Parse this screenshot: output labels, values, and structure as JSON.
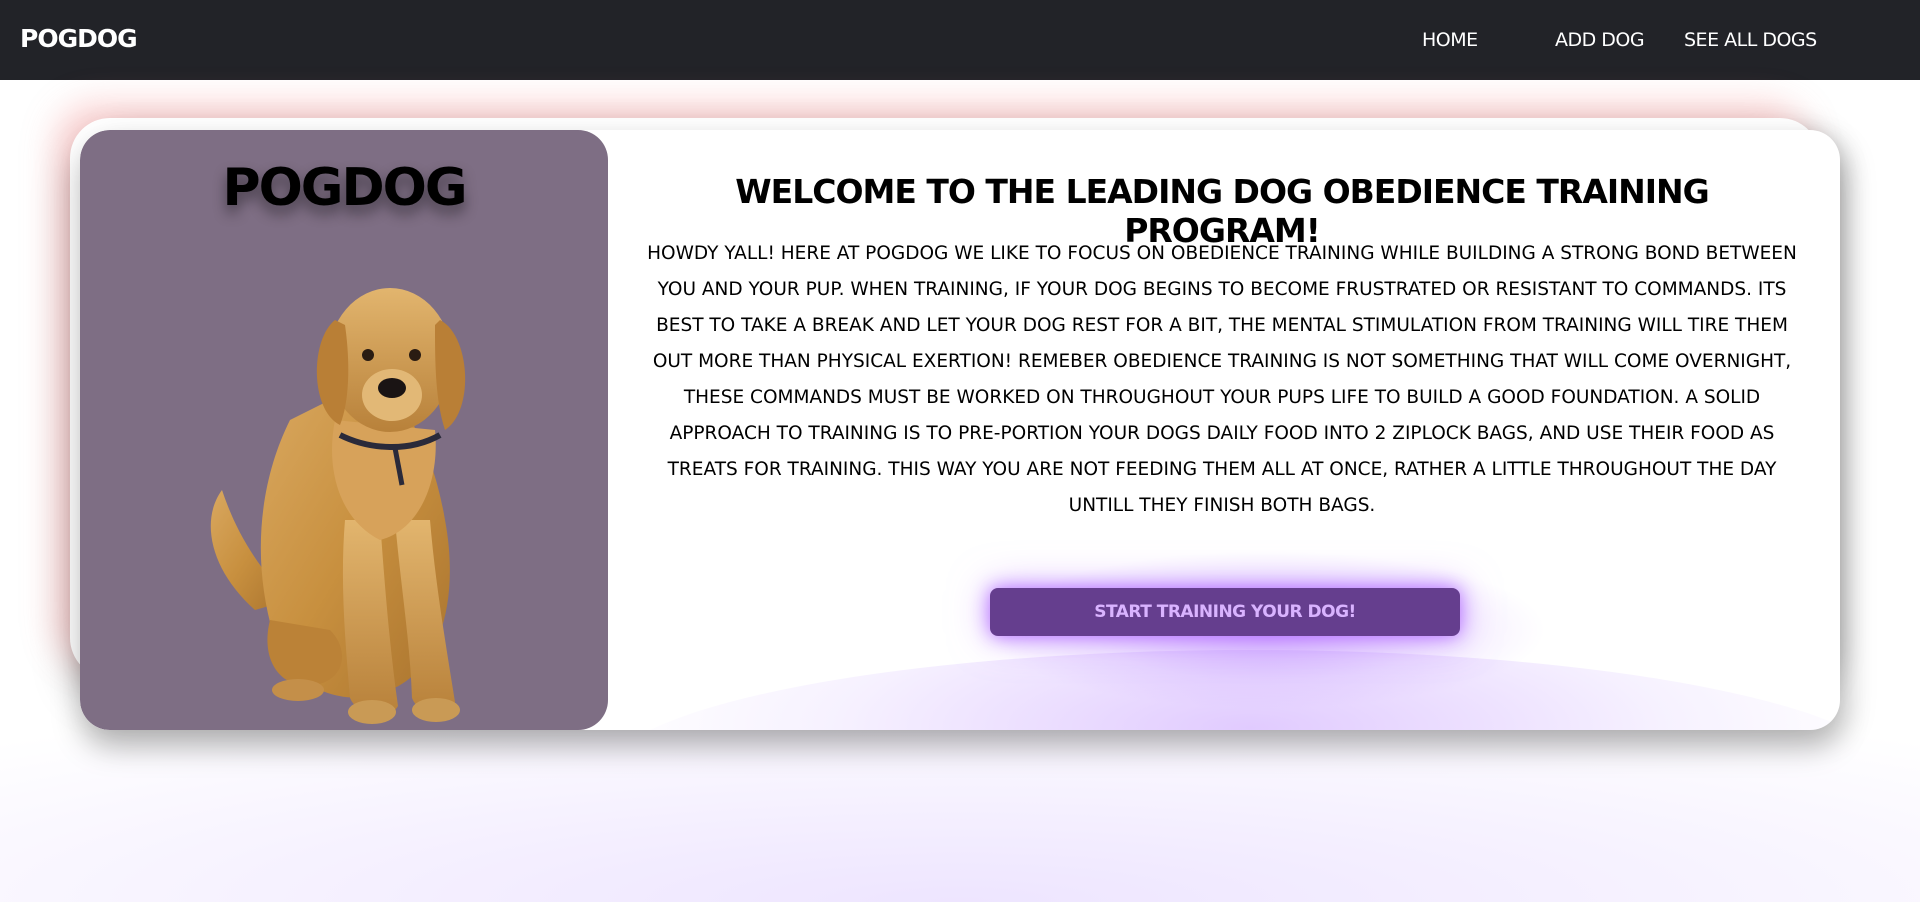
{
  "navbar": {
    "brand": "POGDOG",
    "links": {
      "home": "HOME",
      "add_dog": "ADD DOG",
      "see_all": "SEE ALL DOGS"
    }
  },
  "hero": {
    "title": "POGDOG",
    "image_icon": "golden-retriever-puppy-image",
    "panel_color": "#7e6e84"
  },
  "content": {
    "heading": "WELCOME TO THE LEADING DOG OBEDIENCE TRAINING PROGRAM!",
    "paragraph": "HOWDY YALL! HERE AT POGDOG WE LIKE TO FOCUS ON OBEDIENCE TRAINING WHILE BUILDING A STRONG BOND BETWEEN YOU AND YOUR PUP. WHEN TRAINING, IF YOUR DOG BEGINS TO BECOME FRUSTRATED OR RESISTANT TO COMMANDS. ITS BEST TO TAKE A BREAK AND LET YOUR DOG REST FOR A BIT, THE MENTAL STIMULATION FROM TRAINING WILL TIRE THEM OUT MORE THAN PHYSICAL EXERTION! REMEBER OBEDIENCE TRAINING IS NOT SOMETHING THAT WILL COME OVERNIGHT, THESE COMMANDS MUST BE WORKED ON THROUGHOUT YOUR PUPS LIFE TO BUILD A GOOD FOUNDATION. A SOLID APPROACH TO TRAINING IS TO PRE-PORTION YOUR DOGS DAILY FOOD INTO 2 ZIPLOCK BAGS, AND USE THEIR FOOD AS TREATS FOR TRAINING. THIS WAY YOU ARE NOT FEEDING THEM ALL AT ONCE, RATHER A LITTLE THROUGHOUT THE DAY UNTILL THEY FINISH BOTH BAGS.",
    "cta_label": "START TRAINING YOUR DOG!"
  },
  "colors": {
    "navbar_bg": "#222328",
    "cta_bg": "#653e8e",
    "cta_text": "#d9b3ff",
    "glow_purple": "#b77bff",
    "glow_red": "#f07878"
  }
}
